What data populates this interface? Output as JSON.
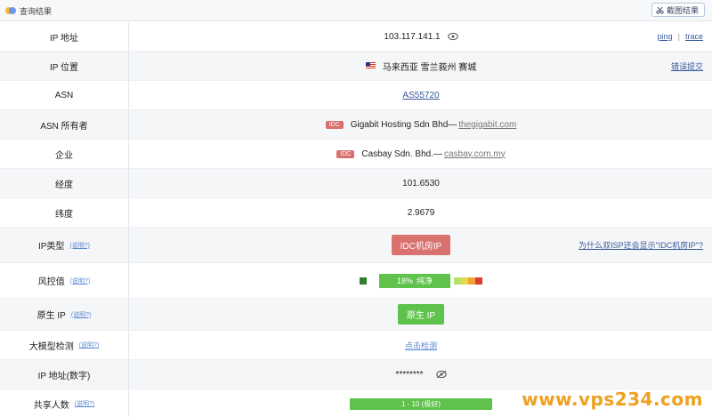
{
  "header": {
    "title": "查询结果",
    "screenshot_button": "截图结果"
  },
  "rows": {
    "ip": {
      "label": "IP 地址",
      "value": "103.117.141.1",
      "ping": "ping",
      "sep": "|",
      "trace": "trace"
    },
    "location": {
      "label": "IP 位置",
      "value": "马来西亚 雪兰莪州 赛城",
      "extra": "错误提交"
    },
    "asn": {
      "label": "ASN",
      "value": "AS55720"
    },
    "asn_owner": {
      "label": "ASN 所有者",
      "tag": "IDC",
      "value": "Gigabit Hosting Sdn Bhd—",
      "domain": "thegigabit.com"
    },
    "company": {
      "label": "企业",
      "tag": "IDC",
      "value": "Casbay Sdn. Bhd.—",
      "domain": "casbay.com.my"
    },
    "longitude": {
      "label": "经度",
      "value": "101.6530"
    },
    "latitude": {
      "label": "纬度",
      "value": "2.9679"
    },
    "ip_type": {
      "label": "IP类型",
      "help": "(说明?)",
      "value": "IDC机房IP",
      "extra": "为什么双ISP还会显示\"IDC机房IP\"?"
    },
    "risk": {
      "label": "风控值",
      "help": "(说明?)",
      "value": "18%",
      "status": "纯净",
      "fill": 0.18,
      "scale_colors": [
        "#b8e06a",
        "#e7d84a",
        "#f2a23a",
        "#d9402f"
      ]
    },
    "native": {
      "label": "原生 IP",
      "help": "(说明?)",
      "value": "原生 IP"
    },
    "llm_check": {
      "label": "大模型检测",
      "help": "(说明?)",
      "value": "点击检测"
    },
    "ip_number": {
      "label": "IP 地址(数字)",
      "value": "********"
    },
    "shared": {
      "label": "共享人数",
      "help": "(说明?)",
      "value": "1 - 10 (极好)"
    }
  },
  "watermark": "www.vps234.com",
  "colors": {
    "green": "#5ec24b",
    "red_tag": "#d9716e",
    "accent": "#3a5a9c"
  }
}
